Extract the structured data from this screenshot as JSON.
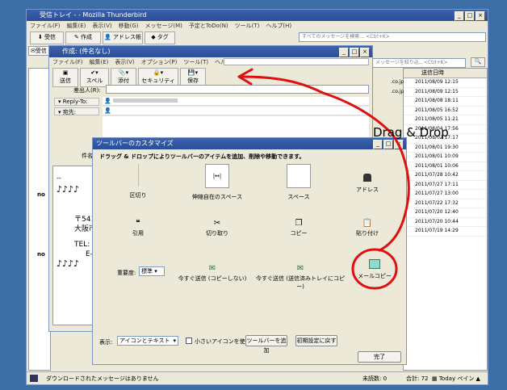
{
  "main": {
    "title": "受信トレイ - ",
    "title_app": " - Mozilla Thunderbird",
    "menu": [
      "ファイル(F)",
      "編集(E)",
      "表示(V)",
      "移動(G)",
      "メッセージ(M)",
      "予定とToDo(N)",
      "ツール(T)",
      "ヘルプ(H)"
    ],
    "toolbar": [
      "受信",
      "作成",
      "アドレス帳",
      "タグ"
    ],
    "search_placeholder": "すべてのメッセージを検索… <Ctrl+K>",
    "tab_label": "受信",
    "filter_placeholder": "メッセージを絞り込…<Ctrl+K>",
    "column_header": "送信日時",
    "email_fragments": [
      ".co.jp",
      ".co.jp"
    ],
    "dates": [
      "2011/08/09 12:15",
      "2011/08/09 12:15",
      "2011/08/08 18:11",
      "2011/08/05 16:52",
      "2011/08/05 11:21",
      "2011/08/04 17:56",
      "2011/08/02 17:17",
      "2011/08/01 19:30",
      "2011/08/01 10:09",
      "2011/08/01 10:06",
      "2011/07/28 10:42",
      "2011/07/27 17:11",
      "2011/07/27 13:00",
      "2011/07/22 17:32",
      "2011/07/20 12:40",
      "2011/07/20 10:44",
      "2011/07/19 14:29"
    ],
    "left_fragments": [
      "no",
      "no"
    ],
    "status_text": "ダウンロードされたメッセージはありません",
    "unread": "未読数: 0",
    "total": "合計: 72",
    "today_pane": "Today ペイン"
  },
  "compose": {
    "title": "作成: (件名なし)",
    "menu": [
      "ファイル(F)",
      "編集(E)",
      "表示(V)",
      "オプション(P)",
      "ツール(T)",
      "ヘルプ(H)"
    ],
    "toolbar": [
      "送信",
      "スペル",
      "添付",
      "セキュリティ",
      "保存"
    ],
    "from_label": "差出人(R):",
    "reply_label": "Reply-To:",
    "to_label": "宛先:",
    "subject_label": "件名(",
    "body_lines": [
      "--",
      "♪♪♪♪",
      "〒541-",
      "大阪市",
      "TEL:",
      "E-m",
      "♪♪♪♪"
    ]
  },
  "customize": {
    "title": "ツールバーのカスタマイズ",
    "instruction": "ドラッグ & ドロップによりツールバーのアイテムを追加、削除や移動できます。",
    "items": [
      "区切り",
      "伸縮自在のスペース",
      "スペース",
      "アドレス",
      "引用",
      "切り取り",
      "コピー",
      "貼り付け",
      "今すぐ送信 (コピーしない)",
      "今すぐ送信 (送信済みトレイにコピー)",
      "メールコピー"
    ],
    "priority_label": "重要度:",
    "priority_value": "標準",
    "show_label": "表示:",
    "show_value": "アイコンとテキスト",
    "small_icons_label": "小さいアイコンを使用",
    "add_toolbar_button": "ツールバーを追加",
    "reset_button": "初期設定に戻す",
    "done_button": "完了"
  },
  "annotation": {
    "text": "Drag & Drop",
    "color": "#e01010"
  }
}
